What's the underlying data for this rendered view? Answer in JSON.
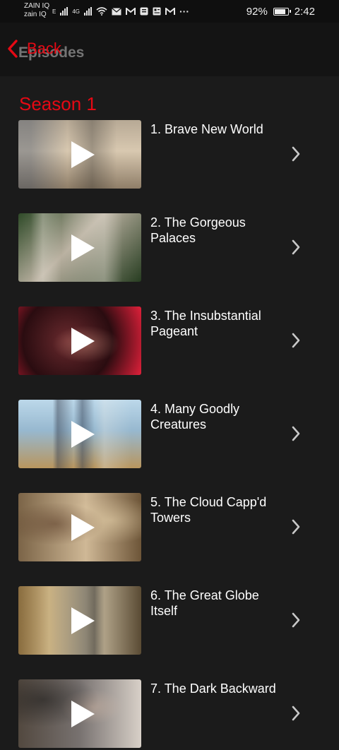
{
  "status_bar": {
    "carrier_1": "ZAIN IQ",
    "carrier_2": "zain IQ",
    "network_1": "E",
    "network_2": "4G",
    "more": "···",
    "battery_percent": "92%",
    "battery_level": 0.92,
    "time": "2:42"
  },
  "nav": {
    "back_label": "Back",
    "title": "Episodes"
  },
  "season": {
    "title": "Season 1"
  },
  "episodes": [
    {
      "title": "1. Brave New World"
    },
    {
      "title": "2. The Gorgeous Palaces"
    },
    {
      "title": "3. The Insubstantial Pageant"
    },
    {
      "title": "4. Many Goodly Creatures"
    },
    {
      "title": "5. The Cloud Capp'd Towers"
    },
    {
      "title": "6. The Great Globe Itself"
    },
    {
      "title": "7. The Dark Backward"
    }
  ],
  "colors": {
    "accent": "#e50914",
    "background": "#1b1b1b",
    "nav_background": "#141414"
  }
}
